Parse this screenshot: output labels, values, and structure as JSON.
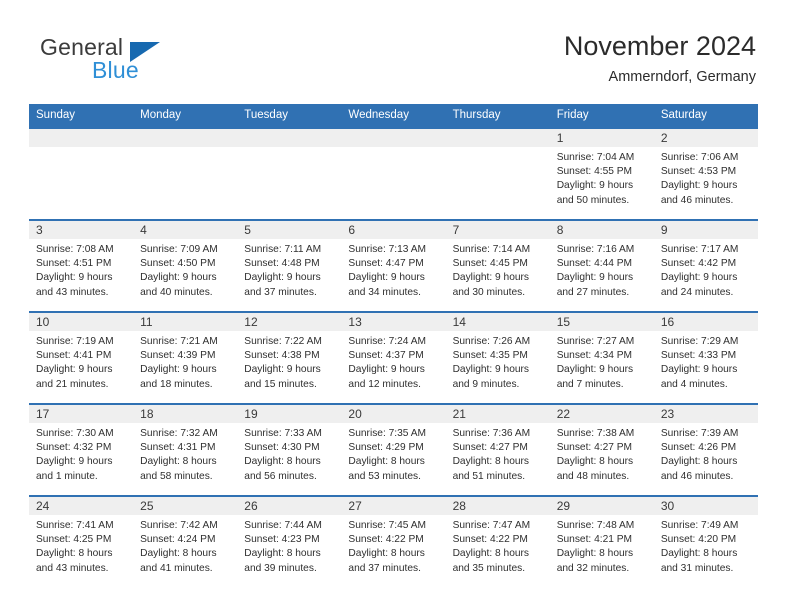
{
  "brand": {
    "name_part1": "General",
    "name_part2": "Blue",
    "triangle_color": "#1769b0",
    "blue_color": "#2f8fd6"
  },
  "header": {
    "title": "November 2024",
    "subtitle": "Ammerndorf, Germany",
    "accent_color": "#3071b3",
    "date_band_color": "#efefef"
  },
  "weekdays": [
    "Sunday",
    "Monday",
    "Tuesday",
    "Wednesday",
    "Thursday",
    "Friday",
    "Saturday"
  ],
  "weeks": [
    [
      {
        "day": "",
        "sunrise": "",
        "sunset": "",
        "daylight1": "",
        "daylight2": ""
      },
      {
        "day": "",
        "sunrise": "",
        "sunset": "",
        "daylight1": "",
        "daylight2": ""
      },
      {
        "day": "",
        "sunrise": "",
        "sunset": "",
        "daylight1": "",
        "daylight2": ""
      },
      {
        "day": "",
        "sunrise": "",
        "sunset": "",
        "daylight1": "",
        "daylight2": ""
      },
      {
        "day": "",
        "sunrise": "",
        "sunset": "",
        "daylight1": "",
        "daylight2": ""
      },
      {
        "day": "1",
        "sunrise": "Sunrise: 7:04 AM",
        "sunset": "Sunset: 4:55 PM",
        "daylight1": "Daylight: 9 hours",
        "daylight2": "and 50 minutes."
      },
      {
        "day": "2",
        "sunrise": "Sunrise: 7:06 AM",
        "sunset": "Sunset: 4:53 PM",
        "daylight1": "Daylight: 9 hours",
        "daylight2": "and 46 minutes."
      }
    ],
    [
      {
        "day": "3",
        "sunrise": "Sunrise: 7:08 AM",
        "sunset": "Sunset: 4:51 PM",
        "daylight1": "Daylight: 9 hours",
        "daylight2": "and 43 minutes."
      },
      {
        "day": "4",
        "sunrise": "Sunrise: 7:09 AM",
        "sunset": "Sunset: 4:50 PM",
        "daylight1": "Daylight: 9 hours",
        "daylight2": "and 40 minutes."
      },
      {
        "day": "5",
        "sunrise": "Sunrise: 7:11 AM",
        "sunset": "Sunset: 4:48 PM",
        "daylight1": "Daylight: 9 hours",
        "daylight2": "and 37 minutes."
      },
      {
        "day": "6",
        "sunrise": "Sunrise: 7:13 AM",
        "sunset": "Sunset: 4:47 PM",
        "daylight1": "Daylight: 9 hours",
        "daylight2": "and 34 minutes."
      },
      {
        "day": "7",
        "sunrise": "Sunrise: 7:14 AM",
        "sunset": "Sunset: 4:45 PM",
        "daylight1": "Daylight: 9 hours",
        "daylight2": "and 30 minutes."
      },
      {
        "day": "8",
        "sunrise": "Sunrise: 7:16 AM",
        "sunset": "Sunset: 4:44 PM",
        "daylight1": "Daylight: 9 hours",
        "daylight2": "and 27 minutes."
      },
      {
        "day": "9",
        "sunrise": "Sunrise: 7:17 AM",
        "sunset": "Sunset: 4:42 PM",
        "daylight1": "Daylight: 9 hours",
        "daylight2": "and 24 minutes."
      }
    ],
    [
      {
        "day": "10",
        "sunrise": "Sunrise: 7:19 AM",
        "sunset": "Sunset: 4:41 PM",
        "daylight1": "Daylight: 9 hours",
        "daylight2": "and 21 minutes."
      },
      {
        "day": "11",
        "sunrise": "Sunrise: 7:21 AM",
        "sunset": "Sunset: 4:39 PM",
        "daylight1": "Daylight: 9 hours",
        "daylight2": "and 18 minutes."
      },
      {
        "day": "12",
        "sunrise": "Sunrise: 7:22 AM",
        "sunset": "Sunset: 4:38 PM",
        "daylight1": "Daylight: 9 hours",
        "daylight2": "and 15 minutes."
      },
      {
        "day": "13",
        "sunrise": "Sunrise: 7:24 AM",
        "sunset": "Sunset: 4:37 PM",
        "daylight1": "Daylight: 9 hours",
        "daylight2": "and 12 minutes."
      },
      {
        "day": "14",
        "sunrise": "Sunrise: 7:26 AM",
        "sunset": "Sunset: 4:35 PM",
        "daylight1": "Daylight: 9 hours",
        "daylight2": "and 9 minutes."
      },
      {
        "day": "15",
        "sunrise": "Sunrise: 7:27 AM",
        "sunset": "Sunset: 4:34 PM",
        "daylight1": "Daylight: 9 hours",
        "daylight2": "and 7 minutes."
      },
      {
        "day": "16",
        "sunrise": "Sunrise: 7:29 AM",
        "sunset": "Sunset: 4:33 PM",
        "daylight1": "Daylight: 9 hours",
        "daylight2": "and 4 minutes."
      }
    ],
    [
      {
        "day": "17",
        "sunrise": "Sunrise: 7:30 AM",
        "sunset": "Sunset: 4:32 PM",
        "daylight1": "Daylight: 9 hours",
        "daylight2": "and 1 minute."
      },
      {
        "day": "18",
        "sunrise": "Sunrise: 7:32 AM",
        "sunset": "Sunset: 4:31 PM",
        "daylight1": "Daylight: 8 hours",
        "daylight2": "and 58 minutes."
      },
      {
        "day": "19",
        "sunrise": "Sunrise: 7:33 AM",
        "sunset": "Sunset: 4:30 PM",
        "daylight1": "Daylight: 8 hours",
        "daylight2": "and 56 minutes."
      },
      {
        "day": "20",
        "sunrise": "Sunrise: 7:35 AM",
        "sunset": "Sunset: 4:29 PM",
        "daylight1": "Daylight: 8 hours",
        "daylight2": "and 53 minutes."
      },
      {
        "day": "21",
        "sunrise": "Sunrise: 7:36 AM",
        "sunset": "Sunset: 4:27 PM",
        "daylight1": "Daylight: 8 hours",
        "daylight2": "and 51 minutes."
      },
      {
        "day": "22",
        "sunrise": "Sunrise: 7:38 AM",
        "sunset": "Sunset: 4:27 PM",
        "daylight1": "Daylight: 8 hours",
        "daylight2": "and 48 minutes."
      },
      {
        "day": "23",
        "sunrise": "Sunrise: 7:39 AM",
        "sunset": "Sunset: 4:26 PM",
        "daylight1": "Daylight: 8 hours",
        "daylight2": "and 46 minutes."
      }
    ],
    [
      {
        "day": "24",
        "sunrise": "Sunrise: 7:41 AM",
        "sunset": "Sunset: 4:25 PM",
        "daylight1": "Daylight: 8 hours",
        "daylight2": "and 43 minutes."
      },
      {
        "day": "25",
        "sunrise": "Sunrise: 7:42 AM",
        "sunset": "Sunset: 4:24 PM",
        "daylight1": "Daylight: 8 hours",
        "daylight2": "and 41 minutes."
      },
      {
        "day": "26",
        "sunrise": "Sunrise: 7:44 AM",
        "sunset": "Sunset: 4:23 PM",
        "daylight1": "Daylight: 8 hours",
        "daylight2": "and 39 minutes."
      },
      {
        "day": "27",
        "sunrise": "Sunrise: 7:45 AM",
        "sunset": "Sunset: 4:22 PM",
        "daylight1": "Daylight: 8 hours",
        "daylight2": "and 37 minutes."
      },
      {
        "day": "28",
        "sunrise": "Sunrise: 7:47 AM",
        "sunset": "Sunset: 4:22 PM",
        "daylight1": "Daylight: 8 hours",
        "daylight2": "and 35 minutes."
      },
      {
        "day": "29",
        "sunrise": "Sunrise: 7:48 AM",
        "sunset": "Sunset: 4:21 PM",
        "daylight1": "Daylight: 8 hours",
        "daylight2": "and 32 minutes."
      },
      {
        "day": "30",
        "sunrise": "Sunrise: 7:49 AM",
        "sunset": "Sunset: 4:20 PM",
        "daylight1": "Daylight: 8 hours",
        "daylight2": "and 31 minutes."
      }
    ]
  ]
}
